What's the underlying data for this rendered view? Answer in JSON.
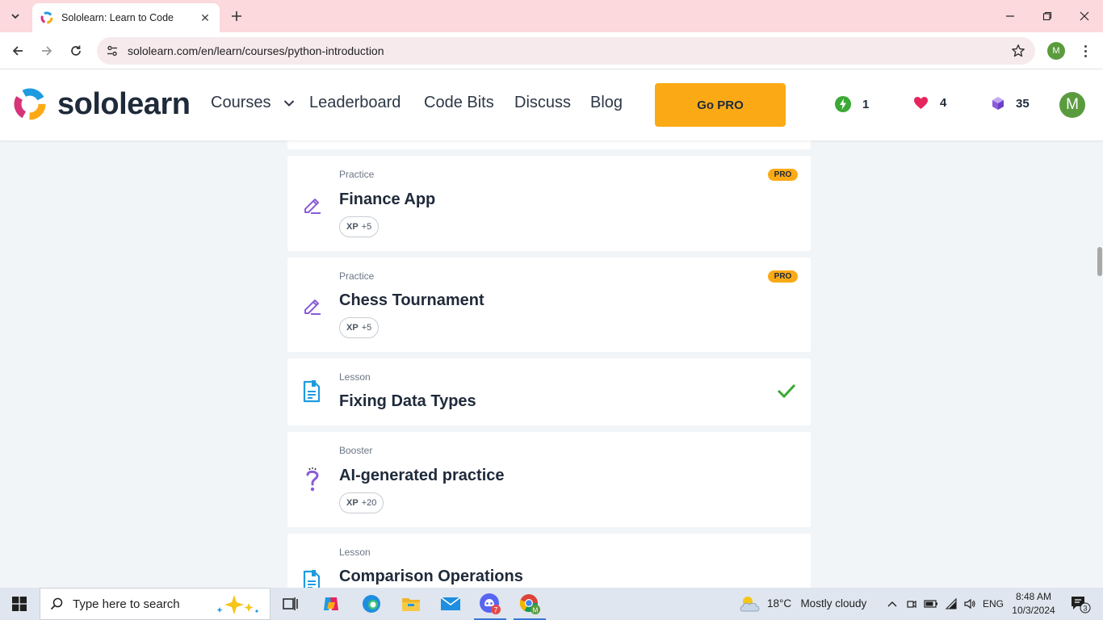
{
  "browser": {
    "tab_title": "Sololearn: Learn to Code",
    "url": "sololearn.com/en/learn/courses/python-introduction",
    "profile_initial": "M"
  },
  "header": {
    "logo_text": "sololearn",
    "nav": {
      "courses": "Courses",
      "leaderboard": "Leaderboard",
      "code_bits": "Code Bits",
      "discuss": "Discuss",
      "blog": "Blog"
    },
    "go_pro": "Go PRO",
    "streak": "1",
    "hearts": "4",
    "gems": "35",
    "avatar_initial": "M"
  },
  "cards": [
    {
      "type": "Practice",
      "title": "Finance App",
      "xp_label": "XP",
      "xp_value": "+5",
      "badge": "PRO",
      "icon": "pencil-icon"
    },
    {
      "type": "Practice",
      "title": "Chess Tournament",
      "xp_label": "XP",
      "xp_value": "+5",
      "badge": "PRO",
      "icon": "pencil-icon"
    },
    {
      "type": "Lesson",
      "title": "Fixing Data Types",
      "completed": true,
      "icon": "document-icon"
    },
    {
      "type": "Booster",
      "title": "AI-generated practice",
      "xp_label": "XP",
      "xp_value": "+20",
      "icon": "question-mark-icon"
    },
    {
      "type": "Lesson",
      "title": "Comparison Operations",
      "icon": "document-icon"
    }
  ],
  "taskbar": {
    "search_placeholder": "Type here to search",
    "weather_temp": "18°C",
    "weather_desc": "Mostly cloudy",
    "language": "ENG",
    "time": "8:48 AM",
    "date": "10/3/2024",
    "notification_count": "3",
    "copilot_badge": "7"
  },
  "colors": {
    "brand_orange": "#fbaa16",
    "pencil_purple": "#8a5cd8",
    "lesson_blue": "#1e9be0",
    "check_green": "#3aa935",
    "tab_strip": "#fbd9dd"
  }
}
